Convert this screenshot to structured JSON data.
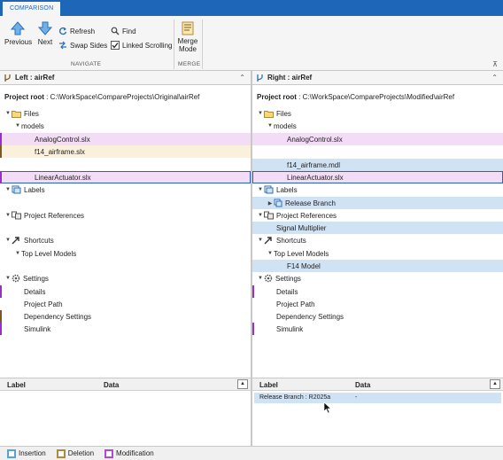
{
  "tab": {
    "label": "COMPARISON"
  },
  "toolbar": {
    "previous_label": "Previous",
    "next_label": "Next",
    "refresh_label": "Refresh",
    "swap_label": "Swap Sides",
    "find_label": "Find",
    "linked_label": "Linked Scrolling",
    "linked_checked": true,
    "merge_label1": "Merge",
    "merge_label2": "Mode",
    "group_navigate": "NAVIGATE",
    "group_merge": "MERGE"
  },
  "left": {
    "title": "Left : airRef",
    "project_root_label": "Project root",
    "project_root_path": ": C:\\WorkSpace\\CompareProjects\\Original\\airRef",
    "rows": {
      "files": "Files",
      "models": "models",
      "analog": "AnalogControl.slx",
      "f14": "f14_airframe.slx",
      "linear": "LinearActuator.slx",
      "labels": "Labels",
      "projrefs": "Project References",
      "shortcuts": "Shortcuts",
      "toplevel": "Top Level Models",
      "settings": "Settings",
      "details": "Details",
      "projpath": "Project Path",
      "depsettings": "Dependency Settings",
      "simulink": "Simulink"
    },
    "table": {
      "col_label": "Label",
      "col_data": "Data"
    }
  },
  "right": {
    "title": "Right : airRef",
    "project_root_label": "Project root",
    "project_root_path": ": C:\\WorkSpace\\CompareProjects\\Modified\\airRef",
    "rows": {
      "files": "Files",
      "models": "models",
      "analog": "AnalogControl.slx",
      "f14": "f14_airframe.mdl",
      "linear": "LinearActuator.slx",
      "labels": "Labels",
      "release": "Release Branch",
      "projrefs": "Project References",
      "signal": "Signal Multiplier",
      "shortcuts": "Shortcuts",
      "toplevel": "Top Level Models",
      "f14model": "F14 Model",
      "settings": "Settings",
      "details": "Details",
      "projpath": "Project Path",
      "depsettings": "Dependency Settings",
      "simulink": "Simulink"
    },
    "table": {
      "col_label": "Label",
      "col_data": "Data",
      "row_label": "Release Branch : R2025a",
      "row_data": "-"
    }
  },
  "legend": {
    "insertion": "Insertion",
    "deletion": "Deletion",
    "modification": "Modification"
  },
  "colors": {
    "insertion": "#5aa0dc",
    "deletion": "#b08a3c",
    "modification": "#b04ad0",
    "accent": "#1e66b8"
  }
}
